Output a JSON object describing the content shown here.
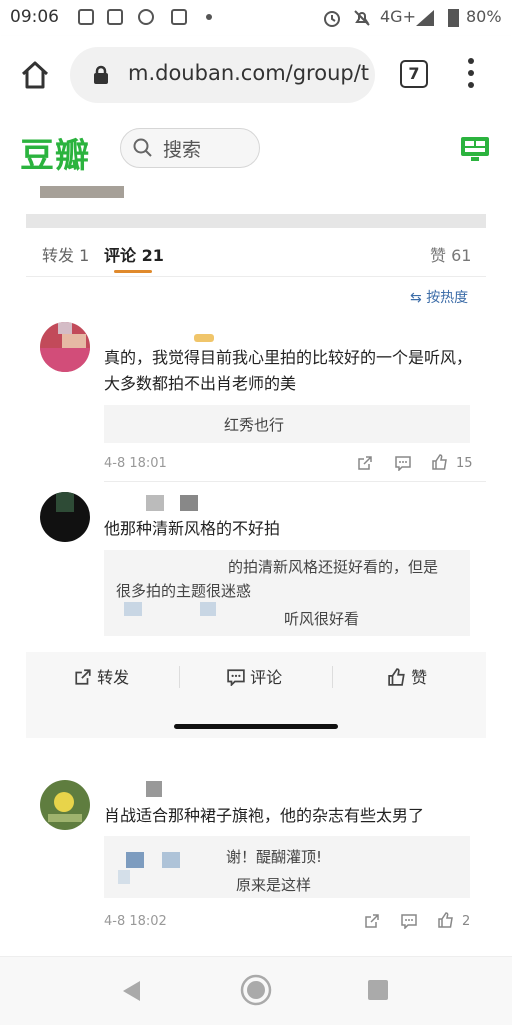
{
  "status_bar": {
    "time": "09:06",
    "network": "4G+",
    "battery": "80%"
  },
  "browser": {
    "url": "m.douban.com/group/t",
    "tab_count": "7"
  },
  "header": {
    "logo": "豆瓣",
    "search_placeholder": "搜索"
  },
  "tabs": {
    "forward": "转发 1",
    "comment": "评论 21",
    "like": "赞 61",
    "sort": "按热度"
  },
  "comments": [
    {
      "text": "真的，我觉得目前我心里拍的比较好的一个是听风，大多数都拍不出肖老师的美",
      "replies": [
        "红秀也行"
      ],
      "time": "4-8 18:01",
      "likes": "15"
    },
    {
      "text": "他那种清新风格的不好拍",
      "replies": [
        "的拍清新风格还挺好看的，但是",
        "很多拍的主题很迷惑",
        "听风很好看"
      ]
    },
    {
      "text": "肖战适合那种裙子旗袍，他的杂志有些太男了",
      "replies": [
        "谢！醍醐灌顶!",
        "原来是这样"
      ],
      "time": "4-8 18:02",
      "likes": "2"
    }
  ],
  "action_bar": {
    "forward": "转发",
    "comment": "评论",
    "like": "赞"
  },
  "colors": {
    "brand": "#2bb33e",
    "link": "#3d6da8",
    "tab_underline": "#e08a2c"
  }
}
